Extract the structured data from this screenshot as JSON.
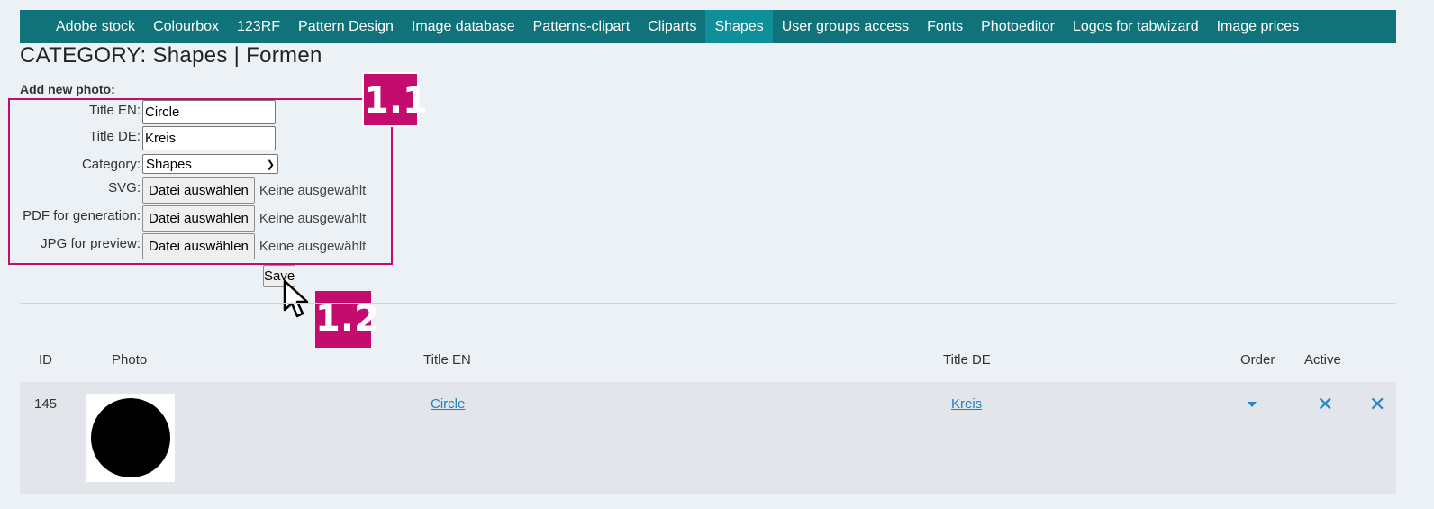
{
  "nav": {
    "items": [
      {
        "label": "Adobe stock",
        "name": "nav-adobe-stock",
        "active": false
      },
      {
        "label": "Colourbox",
        "name": "nav-colourbox",
        "active": false
      },
      {
        "label": "123RF",
        "name": "nav-123rf",
        "active": false
      },
      {
        "label": "Pattern Design",
        "name": "nav-pattern-design",
        "active": false
      },
      {
        "label": "Image database",
        "name": "nav-image-database",
        "active": false
      },
      {
        "label": "Patterns-clipart",
        "name": "nav-patterns-clipart",
        "active": false
      },
      {
        "label": "Cliparts",
        "name": "nav-cliparts",
        "active": false
      },
      {
        "label": "Shapes",
        "name": "nav-shapes",
        "active": true
      },
      {
        "label": "User groups access",
        "name": "nav-user-groups-access",
        "active": false
      },
      {
        "label": "Fonts",
        "name": "nav-fonts",
        "active": false
      },
      {
        "label": "Photoeditor",
        "name": "nav-photoeditor",
        "active": false
      },
      {
        "label": "Logos for tabwizard",
        "name": "nav-logos-for-tabwizard",
        "active": false
      },
      {
        "label": "Image prices",
        "name": "nav-image-prices",
        "active": false
      }
    ]
  },
  "page": {
    "title": "CATEGORY: Shapes | Formen",
    "add_label": "Add new photo:"
  },
  "form": {
    "title_en_label": "Title EN:",
    "title_en_value": "Circle",
    "title_de_label": "Title DE:",
    "title_de_value": "Kreis",
    "category_label": "Category:",
    "category_value": "Shapes",
    "svg_label": "SVG:",
    "pdf_label": "PDF for generation:",
    "jpg_label": "JPG for preview:",
    "file_button": "Datei auswählen",
    "file_status": "Keine ausgewählt",
    "save": "Save"
  },
  "annotations": {
    "badge_1": "1.1",
    "badge_2": "1.2",
    "accent": "#c40b6e"
  },
  "table": {
    "headers": {
      "id": "ID",
      "photo": "Photo",
      "title_en": "Title EN",
      "title_de": "Title DE",
      "order": "Order",
      "active": "Active"
    },
    "rows": [
      {
        "id": "145",
        "title_en": "Circle",
        "title_de": "Kreis"
      }
    ]
  },
  "colors": {
    "nav_bg": "#11737a",
    "nav_active": "#0f8f99",
    "link": "#1f7fbf",
    "page_bg": "#ecf1f6"
  }
}
